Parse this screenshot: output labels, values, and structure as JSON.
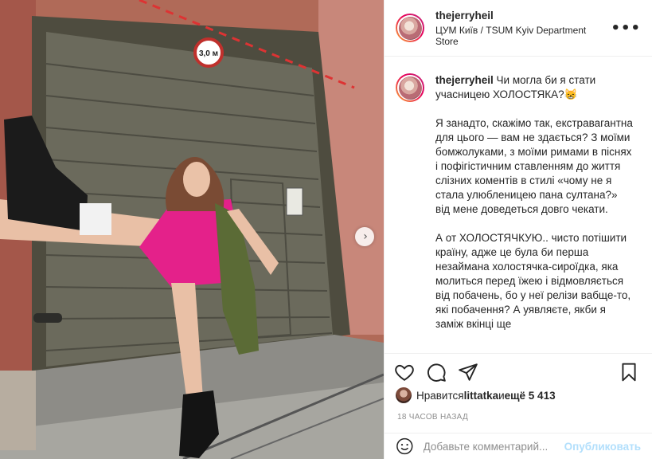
{
  "post": {
    "username": "thejerryheil",
    "location": "ЦУМ Київ / TSUM Kyiv Department Store",
    "more_icon": "more-horizontal-icon"
  },
  "photo": {
    "sign_text": "3,0 м",
    "carousel_total": 3,
    "carousel_index": 0
  },
  "caption": {
    "username": "thejerryheil",
    "line1": "Чи могла би я стати учасницею ХОЛОСТЯКА?😸",
    "para1": "Я занадто, скажімо так, екстравагантна для цього — вам не здається? З моїми бомжолуками, з моїми римами в піснях і пофігістичним ставленням до життя слізних коментів в стилі «чому не я стала улюбленицею пана султана?» від мене доведеться довго чекати.",
    "para2": "А от ХОЛОСТЯЧКУЮ.. чисто потішити країну, адже це була би перша незаймана холостячка-сироїдка, яка молиться перед їжею і відмовляється від побачень, бо у неї релізи вабще-то, які побачення? А уявляєте, якби я заміж вкінці ще"
  },
  "likes": {
    "prefix": "Нравится ",
    "user": "littatka",
    "middle": " и ",
    "rest": "ещё 5 413"
  },
  "timestamp": "18 часов назад",
  "comment": {
    "placeholder": "Добавьте комментарий...",
    "publish_label": "Опубликовать"
  }
}
